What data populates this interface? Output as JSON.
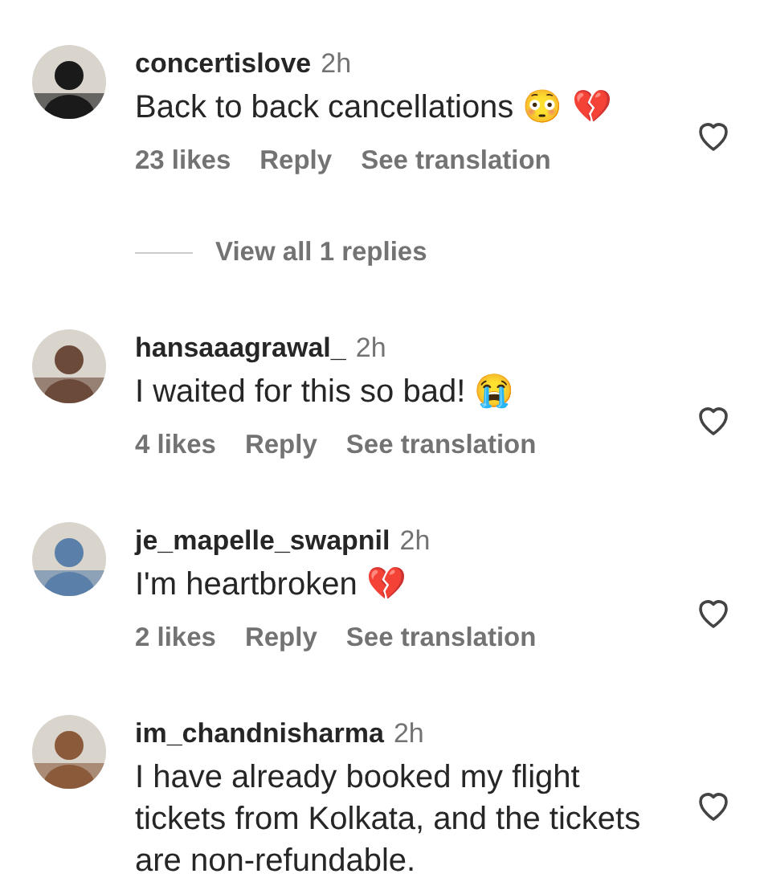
{
  "comments": [
    {
      "username": "concertislove",
      "time": "2h",
      "text": "Back to back cancellations 😳 💔",
      "likes": "23 likes",
      "reply": "Reply",
      "translation": "See translation",
      "liked": false,
      "view_replies": "View all 1 replies"
    },
    {
      "username": "hansaaagrawal_",
      "time": "2h",
      "text": "I waited for this so bad! 😭",
      "likes": "4 likes",
      "reply": "Reply",
      "translation": "See translation",
      "liked": false
    },
    {
      "username": "je_mapelle_swapnil",
      "time": "2h",
      "text": "I'm heartbroken 💔",
      "likes": "2 likes",
      "reply": "Reply",
      "translation": "See translation",
      "liked": false
    },
    {
      "username": "im_chandnisharma",
      "time": "2h",
      "text": "I have already booked my flight tickets from Kolkata, and the tickets are non-refundable.",
      "liked": false
    }
  ]
}
